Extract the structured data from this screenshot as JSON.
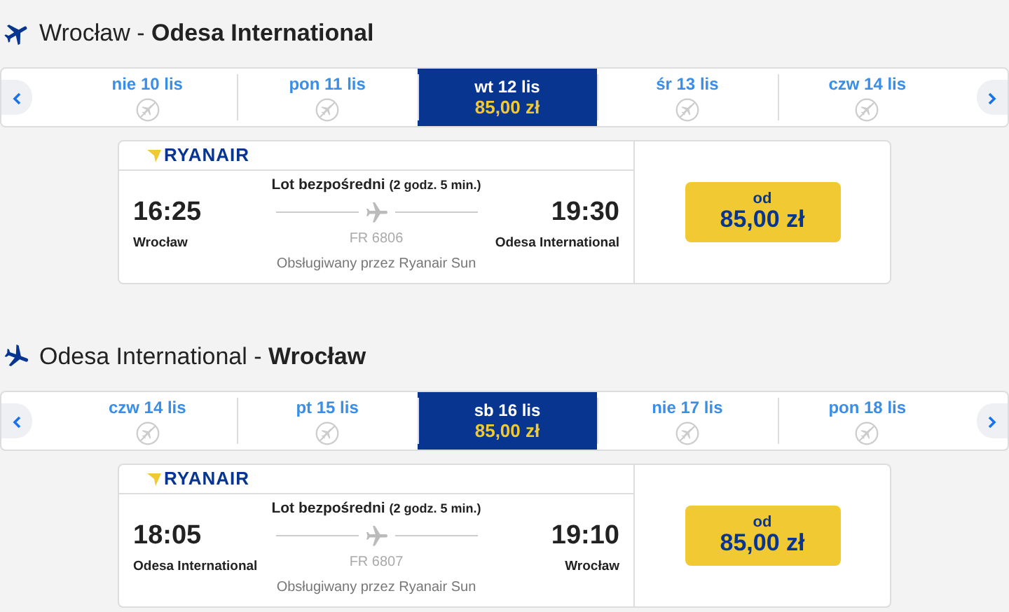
{
  "journeys": [
    {
      "kind": "takeoff",
      "route": "Wrocław - **Odesa International**",
      "dates": [
        {
          "label": "nie 10 lis",
          "selected": false
        },
        {
          "label": "pon 11 lis",
          "selected": false
        },
        {
          "label": "wt 12 lis",
          "price": "85,00 zł",
          "selected": true
        },
        {
          "label": "śr 13 lis",
          "selected": false
        },
        {
          "label": "czw 14 lis",
          "selected": false
        }
      ],
      "flight": {
        "airline": "RYANAIR",
        "type": "Lot bezpośredni",
        "duration": "(2 godz. 5 min.)",
        "depart_time": "16:25",
        "arrive_time": "19:30",
        "depart_city": "Wrocław",
        "arrive_city": "Odesa International",
        "number": "FR 6806",
        "operator": "Obsługiwany przez Ryanair Sun",
        "price_prefix": "od",
        "price": "85,00 zł"
      }
    },
    {
      "kind": "landing",
      "route": "Odesa International - **Wrocław**",
      "dates": [
        {
          "label": "czw 14 lis",
          "selected": false
        },
        {
          "label": "pt 15 lis",
          "selected": false
        },
        {
          "label": "sb 16 lis",
          "price": "85,00 zł",
          "selected": true
        },
        {
          "label": "nie 17 lis",
          "selected": false
        },
        {
          "label": "pon 18 lis",
          "selected": false
        }
      ],
      "flight": {
        "airline": "RYANAIR",
        "type": "Lot bezpośredni",
        "duration": "(2 godz. 5 min.)",
        "depart_time": "18:05",
        "arrive_time": "19:10",
        "depart_city": "Odesa International",
        "arrive_city": "Wrocław",
        "number": "FR 6807",
        "operator": "Obsługiwany przez Ryanair Sun",
        "price_prefix": "od",
        "price": "85,00 zł"
      }
    }
  ]
}
